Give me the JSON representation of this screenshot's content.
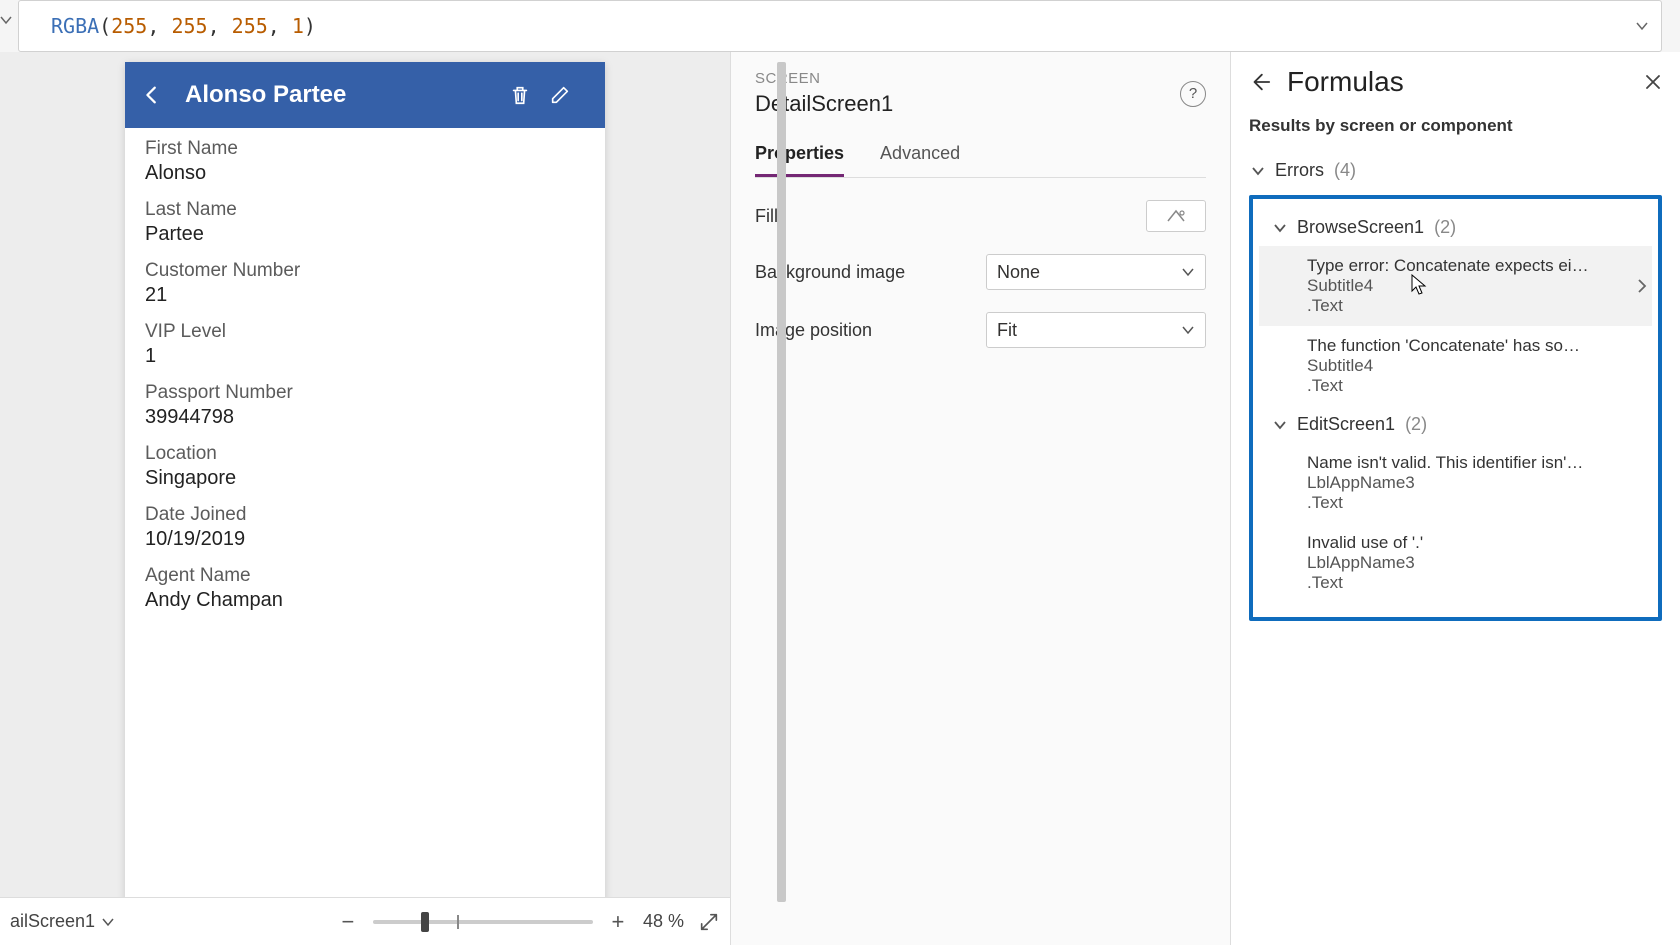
{
  "formulaBar": {
    "func": "RGBA",
    "args": [
      "255",
      "255",
      "255",
      "1"
    ]
  },
  "device": {
    "headerTitle": "Alonso Partee",
    "fields": [
      {
        "label": "First Name",
        "value": "Alonso"
      },
      {
        "label": "Last Name",
        "value": "Partee"
      },
      {
        "label": "Customer Number",
        "value": "21"
      },
      {
        "label": "VIP Level",
        "value": "1"
      },
      {
        "label": "Passport Number",
        "value": "39944798"
      },
      {
        "label": "Location",
        "value": "Singapore"
      },
      {
        "label": "Date Joined",
        "value": "10/19/2019"
      },
      {
        "label": "Agent Name",
        "value": "Andy Champan"
      }
    ]
  },
  "statusBar": {
    "screenName": "ailScreen1",
    "zoomPercent": "48",
    "zoomUnit": "%"
  },
  "propsPanel": {
    "kicker": "SCREEN",
    "title": "DetailScreen1",
    "tabs": {
      "properties": "Properties",
      "advanced": "Advanced"
    },
    "rows": {
      "fill": "Fill",
      "bgImage": {
        "label": "Background image",
        "value": "None"
      },
      "imgPos": {
        "label": "Image position",
        "value": "Fit"
      }
    }
  },
  "formulasPanel": {
    "title": "Formulas",
    "resultsLabel": "Results by screen or component",
    "errorsGroup": {
      "label": "Errors",
      "count": "(4)"
    },
    "groups": [
      {
        "label": "BrowseScreen1",
        "count": "(2)",
        "items": [
          {
            "msg": "Type error: Concatenate expects ei…",
            "ctrl": "Subtitle4",
            "prop": ".Text",
            "hovered": true,
            "hasChevron": true
          },
          {
            "msg": "The function 'Concatenate' has so…",
            "ctrl": "Subtitle4",
            "prop": ".Text"
          }
        ]
      },
      {
        "label": "EditScreen1",
        "count": "(2)",
        "items": [
          {
            "msg": "Name isn't valid. This identifier isn'…",
            "ctrl": "LblAppName3",
            "prop": ".Text"
          },
          {
            "msg": "Invalid use of '.'",
            "ctrl": "LblAppName3",
            "prop": ".Text"
          }
        ]
      }
    ]
  }
}
